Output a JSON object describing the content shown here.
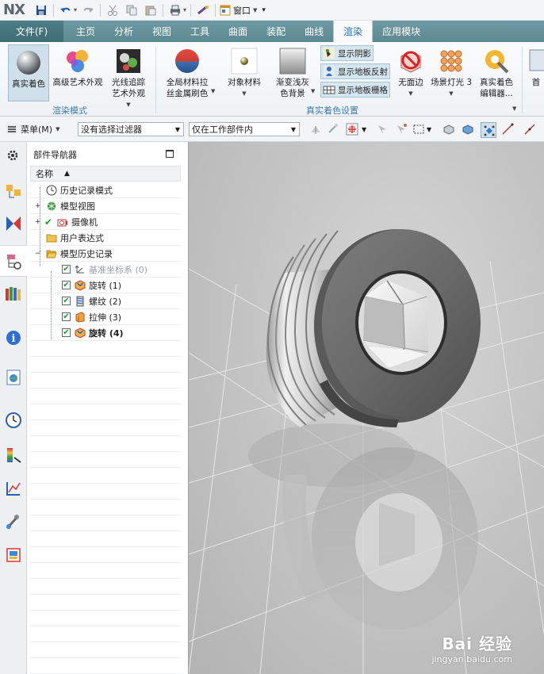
{
  "app": {
    "logo": "NX",
    "window_menu": "窗口"
  },
  "quick_access": {
    "icons": [
      "save-icon",
      "undo-icon",
      "redo-icon",
      "cut-icon",
      "copy-icon",
      "paste-icon",
      "print-icon",
      "repeat-command-icon",
      "window-icon"
    ]
  },
  "tabs": [
    {
      "label": "文件(F)"
    },
    {
      "label": "主页"
    },
    {
      "label": "分析"
    },
    {
      "label": "视图"
    },
    {
      "label": "工具"
    },
    {
      "label": "曲面"
    },
    {
      "label": "装配"
    },
    {
      "label": "曲线"
    },
    {
      "label": "渲染",
      "active": true
    },
    {
      "label": "应用模块"
    }
  ],
  "ribbon": {
    "true_shading": "真实着色",
    "advanced_studio_1": "高级艺术外观",
    "ray_trace_1": "光线追踪",
    "ray_trace_2": "艺术外观",
    "render_mode_group": "渲染模式",
    "global_material_1": "全局材料拉",
    "global_material_2": "丝金属刷色",
    "object_material": "对象材料",
    "gradient_bg_1": "渐变浅灰",
    "gradient_bg_2": "色背景",
    "show_shadow": "显示阴影",
    "show_floor_reflection": "显示地板反射",
    "show_floor_grid": "显示地板栅格",
    "no_edges": "无面边",
    "scene_lights": "场景灯光 3",
    "true_shading_editor_1": "真实着色",
    "true_shading_editor_2": "编辑器...",
    "preferences_cut": "首",
    "true_shading_settings_group": "真实着色设置",
    "accent_color": "#3f7cac"
  },
  "selection_bar": {
    "menu_label": "菜单(M)",
    "type_filter": "没有选择过滤器",
    "scope_filter": "仅在工作部件内"
  },
  "navigator": {
    "title": "部件导航器",
    "column_name": "名称",
    "items": [
      {
        "label": "历史记录模式",
        "icon": "clock-icon"
      },
      {
        "label": "模型视图",
        "icon": "model-views-icon"
      },
      {
        "label": "摄像机",
        "icon": "camera-icon"
      },
      {
        "label": "用户表达式",
        "icon": "folder-icon"
      },
      {
        "label": "模型历史记录",
        "icon": "folder-open-icon"
      },
      {
        "label": "基准坐标系 (0)",
        "icon": "datum-csys-icon"
      },
      {
        "label": "旋转 (1)",
        "icon": "revolve-icon"
      },
      {
        "label": "螺纹 (2)",
        "icon": "thread-icon"
      },
      {
        "label": "拉伸 (3)",
        "icon": "extrude-icon"
      },
      {
        "label": "旋转 (4)",
        "icon": "revolve-icon"
      }
    ]
  },
  "viewport": {
    "model": "threaded-plug-with-hex-socket",
    "background": "#c6c6c6"
  },
  "watermark": {
    "brand": "Bai 经验",
    "url": "jingyan.baidu.com"
  }
}
